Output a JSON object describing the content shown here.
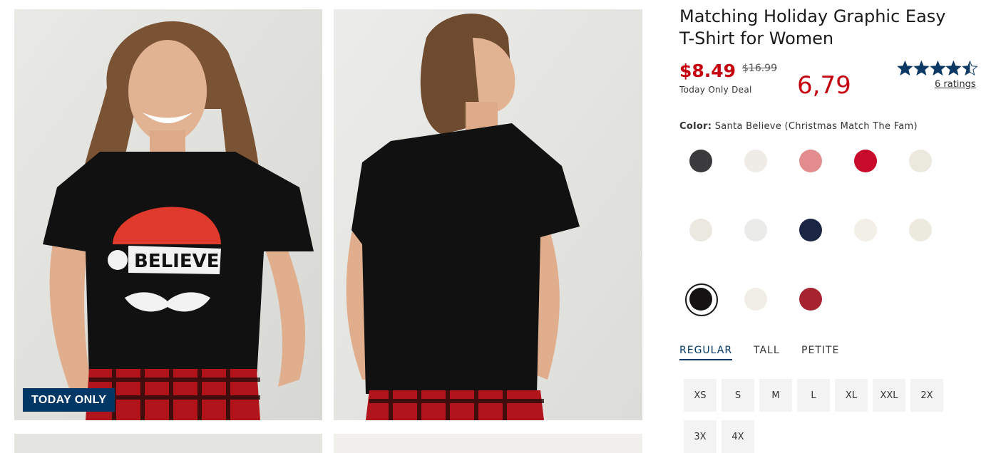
{
  "gallery": {
    "badge": "TODAY ONLY",
    "shirt_print": "BELIEVE"
  },
  "product": {
    "title_line1": "Matching Holiday Graphic Easy",
    "title_line2": "T-Shirt for Women",
    "sale_price": "$8.49",
    "original_price": "$16.99",
    "deal_text": "Today Only Deal",
    "overlay_price": "6,79",
    "rating": 4.5,
    "ratings_count_label": "6 ratings"
  },
  "color": {
    "label": "Color:",
    "selected_name": "Santa Believe (Christmas Match The Fam)",
    "swatches": [
      {
        "hex": "#3b3b3e"
      },
      {
        "hex": "#efece7"
      },
      {
        "hex": "#e38c8e"
      },
      {
        "hex": "#c80a2c"
      },
      {
        "hex": "#ebe8de"
      },
      {
        "hex": "#ebe8e0"
      },
      {
        "hex": "#ebebea"
      },
      {
        "hex": "#1b2645"
      },
      {
        "hex": "#f1efe6"
      },
      {
        "hex": "#ece9df"
      },
      {
        "hex": "#141213",
        "selected": true
      },
      {
        "hex": "#f0eee7"
      },
      {
        "hex": "#a62330"
      }
    ]
  },
  "fit_tabs": [
    {
      "label": "REGULAR",
      "active": true
    },
    {
      "label": "TALL"
    },
    {
      "label": "PETITE"
    }
  ],
  "sizes": [
    "XS",
    "S",
    "M",
    "L",
    "XL",
    "XXL",
    "2X",
    "3X",
    "4X"
  ],
  "colors": {
    "brand_navy": "#003764",
    "sale_red": "#c5000f",
    "star_navy": "#0b3963"
  }
}
